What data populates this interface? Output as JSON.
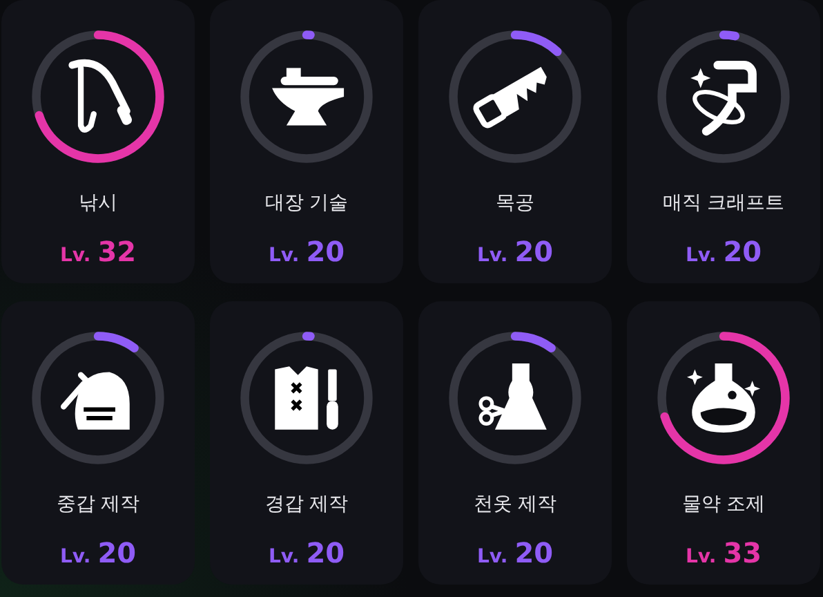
{
  "skills": [
    {
      "name": "낚시",
      "lv": "Lv.",
      "level_num": "32",
      "level": 0.7,
      "color": "#e535a8"
    },
    {
      "name": "대장 기술",
      "lv": "Lv.",
      "level_num": "20",
      "level": 0.01,
      "color": "#8f5cf6"
    },
    {
      "name": "목공",
      "lv": "Lv.",
      "level_num": "20",
      "level": 0.12,
      "color": "#8f5cf6"
    },
    {
      "name": "매직 크래프트",
      "lv": "Lv.",
      "level_num": "20",
      "level": 0.03,
      "color": "#8f5cf6"
    },
    {
      "name": "중갑 제작",
      "lv": "Lv.",
      "level_num": "20",
      "level": 0.1,
      "color": "#8f5cf6"
    },
    {
      "name": "경갑 제작",
      "lv": "Lv.",
      "level_num": "20",
      "level": 0.01,
      "color": "#8f5cf6"
    },
    {
      "name": "천옷 제작",
      "lv": "Lv.",
      "level_num": "20",
      "level": 0.1,
      "color": "#8f5cf6"
    },
    {
      "name": "물약 조제",
      "lv": "Lv.",
      "level_num": "33",
      "level": 0.7,
      "color": "#e535a8"
    }
  ]
}
